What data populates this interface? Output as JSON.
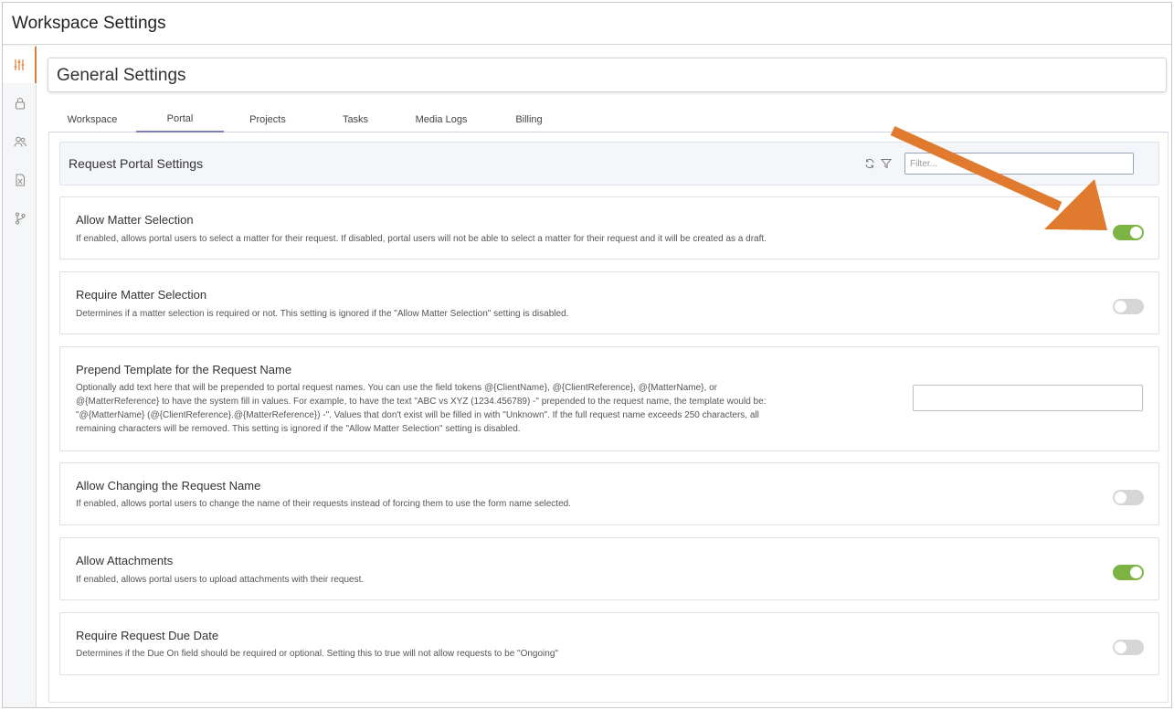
{
  "window": {
    "title": "Workspace Settings"
  },
  "sidebar": {
    "items": [
      {
        "icon": "sliders-icon",
        "active": true
      },
      {
        "icon": "lock-icon",
        "active": false
      },
      {
        "icon": "users-icon",
        "active": false
      },
      {
        "icon": "excel-file-icon",
        "active": false
      },
      {
        "icon": "branch-icon",
        "active": false
      }
    ]
  },
  "page": {
    "title": "General Settings"
  },
  "tabs": [
    {
      "label": "Workspace",
      "active": false
    },
    {
      "label": "Portal",
      "active": true
    },
    {
      "label": "Projects",
      "active": false
    },
    {
      "label": "Tasks",
      "active": false
    },
    {
      "label": "Media Logs",
      "active": false
    },
    {
      "label": "Billing",
      "active": false
    }
  ],
  "section": {
    "title": "Request Portal Settings",
    "filter_placeholder": "Filter...",
    "refresh_icon": "refresh-icon",
    "filter_icon": "funnel-icon"
  },
  "settings": [
    {
      "title": "Allow Matter Selection",
      "description": "If enabled, allows portal users to select a matter for their request. If disabled, portal users will not be able to select a matter for their request and it will be created as a draft.",
      "enabled": true
    },
    {
      "title": "Require Matter Selection",
      "description": "Determines if a matter selection is required or not. This setting is ignored if the \"Allow Matter Selection\" setting is disabled.",
      "enabled": false
    },
    {
      "title": "Prepend Template for the Request Name",
      "description_lines": [
        "Optionally add text here that will be prepended to portal request names. You can use the field tokens @{ClientName}, @{ClientReference}, @{MatterName}, or",
        "@{MatterReference} to have the system fill in values. For example, to have the text \"ABC vs XYZ (1234.456789) -\" prepended to the request name, the template would be:",
        "\"@{MatterName} (@{ClientReference}.@{MatterReference}) -\". Values that don't exist will be filled in with \"Unknown\". If the full request name exceeds 250 characters, all",
        "remaining characters will be removed. This setting is ignored if the \"Allow Matter Selection\" setting is disabled."
      ],
      "value": ""
    },
    {
      "title": "Allow Changing the Request Name",
      "description": "If enabled, allows portal users to change the name of their requests instead of forcing them to use the form name selected.",
      "enabled": false
    },
    {
      "title": "Allow Attachments",
      "description": "If enabled, allows portal users to upload attachments with their request.",
      "enabled": true
    },
    {
      "title": "Require Request Due Date",
      "description": "Determines if the Due On field should be required or optional. Setting this to true will not allow requests to be \"Ongoing\"",
      "enabled": false
    }
  ],
  "colors": {
    "accent": "#e07a3a",
    "toggle_on": "#7cb342",
    "toggle_off": "#d6d6d6",
    "annotation_arrow": "#e07a2e"
  }
}
